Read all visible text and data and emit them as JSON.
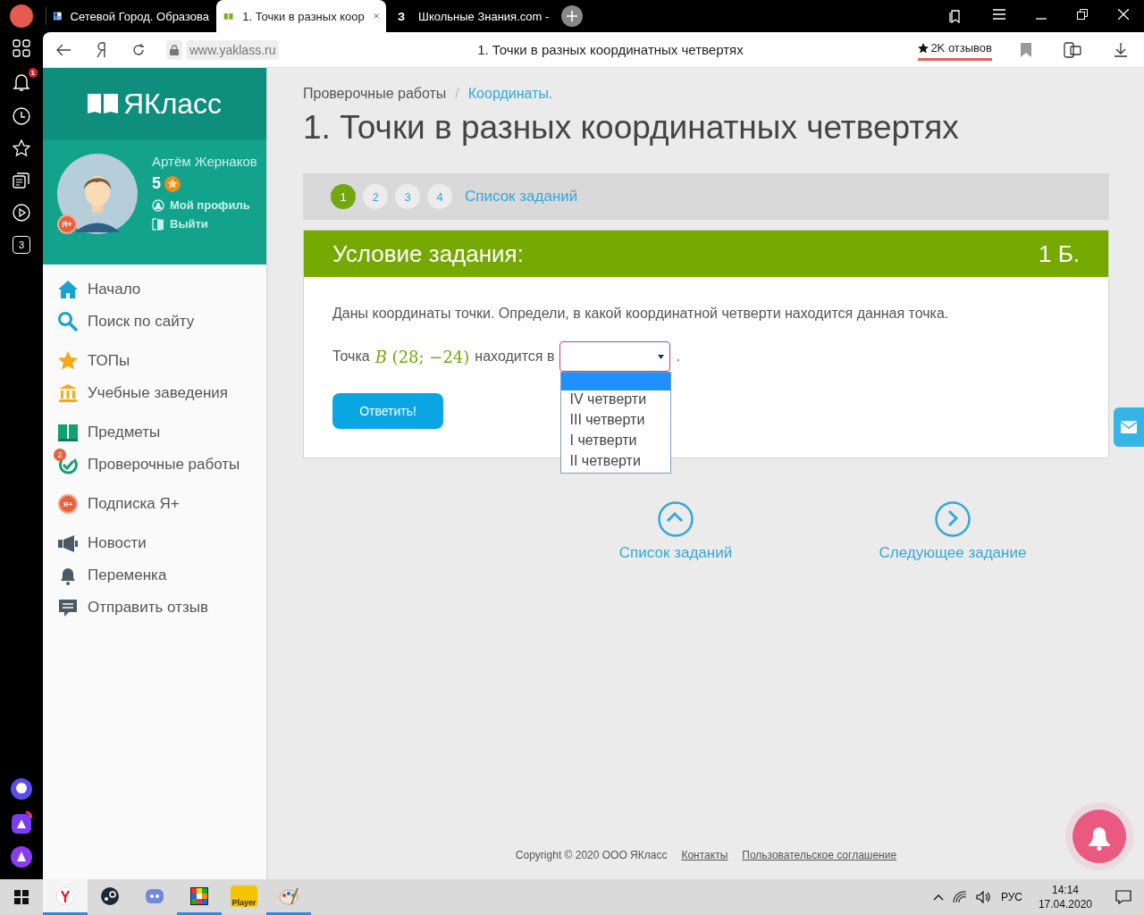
{
  "browser": {
    "tabs": [
      {
        "title": "Сетевой Город. Образова",
        "selected": false
      },
      {
        "title": "1. Точки в разных коор",
        "selected": true
      },
      {
        "title": "Школьные Знания.com -",
        "favicon_text": "З",
        "selected": false
      }
    ],
    "side_panel": {
      "notification_badge": "1",
      "zen_text": "3"
    },
    "address": {
      "url": "www.yaklass.ru",
      "page_title": "1. Точки в разных координатных четвертях",
      "reviews": "2K отзывов"
    }
  },
  "site": {
    "logo": "ЯКласс",
    "user": {
      "name": "Артём Жернаков",
      "score": "5",
      "badge": "Я+",
      "links": [
        "Мой профиль",
        "Выйти"
      ]
    },
    "nav": [
      [
        "Начало",
        "Поиск по сайту"
      ],
      [
        "ТОПы",
        "Учебные заведения"
      ],
      [
        "Предметы",
        {
          "label": "Проверочные работы",
          "badge": "2"
        }
      ],
      [
        {
          "label": "Подписка Я+",
          "icon_text": "Я+"
        }
      ],
      [
        "Новости",
        "Переменка",
        "Отправить отзыв"
      ]
    ]
  },
  "breadcrumb": [
    {
      "label": "Проверочные работы",
      "link": false
    },
    {
      "label": "Координаты.",
      "link": true
    }
  ],
  "breadcrumb_separator": "/",
  "title": "1. Точки в разных координатных четвертях",
  "steps": [
    {
      "label": "1",
      "selected": true
    },
    {
      "label": "2",
      "selected": false
    },
    {
      "label": "3",
      "selected": false
    },
    {
      "label": "4",
      "selected": false
    }
  ],
  "steps_link": "Список заданий",
  "task": {
    "header": "Условие задания:",
    "points": "1 Б.",
    "text": "Даны координаты точки. Определи, в какой координатной четверти находится данная точка.",
    "before": "Точка",
    "math": "*B* (28; −24)",
    "middle": "находится в",
    "after": ".",
    "dropdown": {
      "open": true,
      "blank_highlighted": true,
      "options": [
        "IV четверти",
        "III четверти",
        "I четверти",
        "II четверти"
      ]
    },
    "button": "Ответить!"
  },
  "task_nav": [
    "Список заданий",
    "Следующее задание"
  ],
  "footer": {
    "copyright": "Copyright © 2020 ООО ЯКласс",
    "links": [
      "Контакты",
      "Пользовательское соглашение"
    ]
  },
  "taskbar": {
    "apps": [
      {
        "active": true,
        "running": true
      },
      {
        "active": false,
        "running": false
      },
      {
        "active": false,
        "running": false
      },
      {
        "active": false,
        "running": true
      },
      {
        "label": "Player",
        "active": false,
        "running": false
      },
      {
        "active": false,
        "running": true
      }
    ],
    "language": "РУС",
    "time": "14:14",
    "date": "17.04.2020"
  }
}
